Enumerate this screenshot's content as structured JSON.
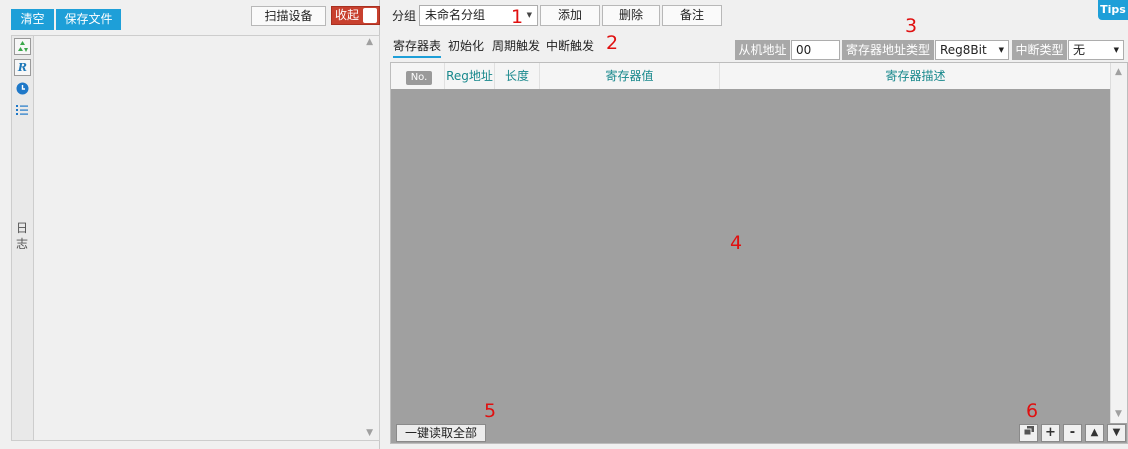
{
  "left": {
    "clear_label": "清空",
    "save_file_label": "保存文件",
    "scan_label": "扫描设备",
    "collapse_label": "收起",
    "log_label_1": "日",
    "log_label_2": "志"
  },
  "toolbar": {
    "group_label": "分组",
    "group_value": "未命名分组",
    "add_label": "添加",
    "delete_label": "删除",
    "note_label": "备注",
    "tips_label": "Tips"
  },
  "tabs": [
    {
      "label": "寄存器表",
      "active": true
    },
    {
      "label": "初始化",
      "active": false
    },
    {
      "label": "周期触发",
      "active": false
    },
    {
      "label": "中断触发",
      "active": false
    }
  ],
  "settings": {
    "slave_addr_label": "从机地址",
    "slave_addr_value": "00",
    "reg_addr_type_label": "寄存器地址类型",
    "reg_addr_type_value": "Reg8Bit",
    "int_type_label": "中断类型",
    "int_type_value": "无"
  },
  "table": {
    "columns": [
      "No.",
      "Reg地址",
      "长度",
      "寄存器值",
      "寄存器描述"
    ],
    "rows": []
  },
  "footer": {
    "read_all_label": "一键读取全部",
    "plus_label": "+",
    "minus_label": "-",
    "up_label": "▲",
    "down_label": "▼"
  },
  "annotations": [
    "1",
    "2",
    "3",
    "4",
    "5",
    "6"
  ],
  "colors": {
    "accent": "#1e9fd8",
    "toggle": "#c8402e",
    "annotation": "#e01010",
    "table_bg": "#a0a0a0",
    "header_text": "#17888c"
  }
}
